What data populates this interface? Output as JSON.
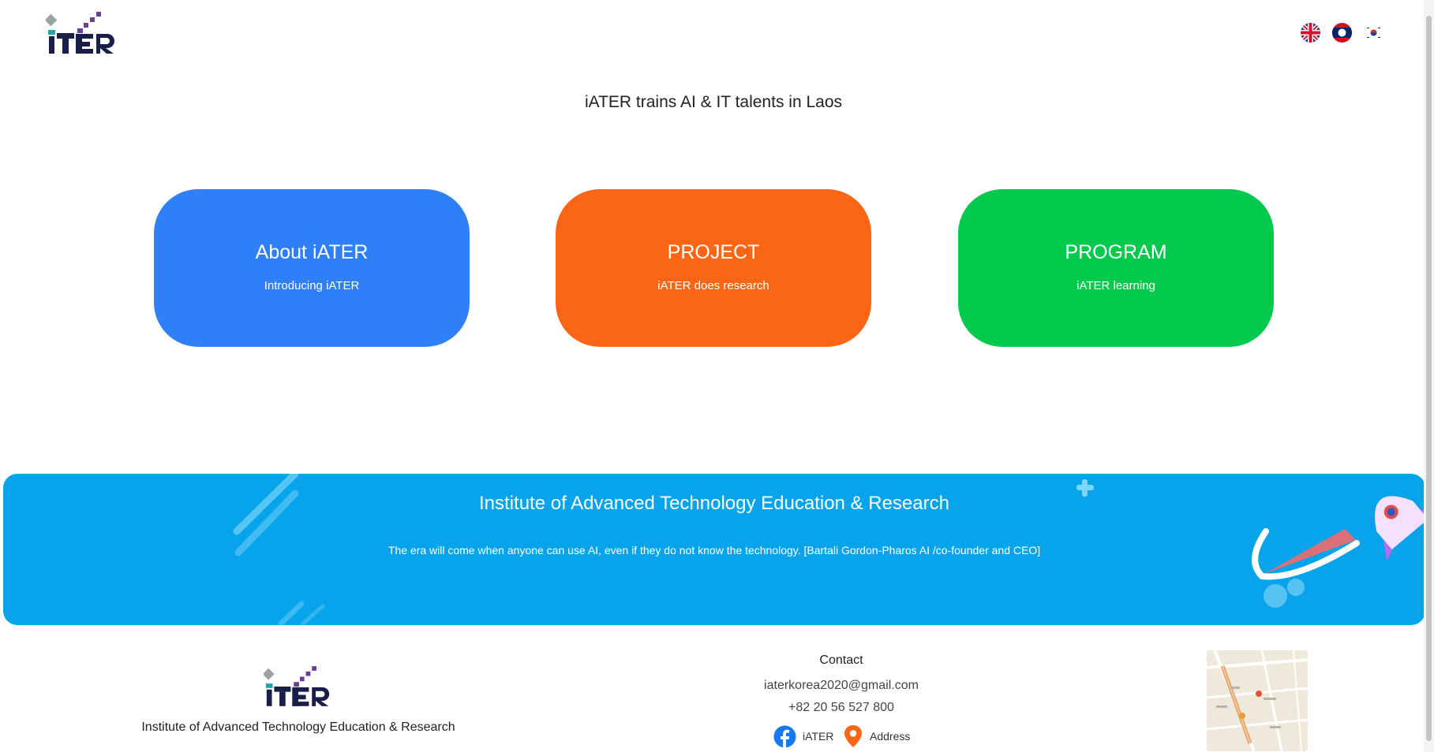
{
  "header": {
    "logo_text": "iATER",
    "languages": [
      {
        "code": "en",
        "icon": "uk-flag-icon"
      },
      {
        "code": "lo",
        "icon": "laos-flag-icon"
      },
      {
        "code": "ko",
        "icon": "korea-flag-icon"
      }
    ]
  },
  "tagline": "iATER trains AI & IT talents in Laos",
  "cards": [
    {
      "title": "About iATER",
      "subtitle": "Introducing iATER",
      "color": "#2f7ff8"
    },
    {
      "title": "PROJECT",
      "subtitle": "iATER does research",
      "color": "#fb6616"
    },
    {
      "title": "PROGRAM",
      "subtitle": "iATER learning",
      "color": "#03c94d"
    }
  ],
  "banner": {
    "title": "Institute of Advanced Technology Education & Research",
    "quote": "The era will come when anyone can use AI, even if they do not know the technology. [Bartali Gordon-Pharos AI /co-founder and CEO]",
    "color": "#07a4ec"
  },
  "footer": {
    "org_name": "Institute of Advanced Technology Education & Research",
    "contact_title": "Contact",
    "email": "iaterkorea2020@gmail.com",
    "phone": "+82 20 56 527 800",
    "facebook_label": "iATER",
    "address_label": "Address"
  },
  "colors": {
    "accent_blue": "#2f7ff8",
    "accent_orange": "#fb6616",
    "accent_green": "#03c94d",
    "banner_blue": "#07a4ec",
    "facebook_blue": "#1877f2"
  }
}
